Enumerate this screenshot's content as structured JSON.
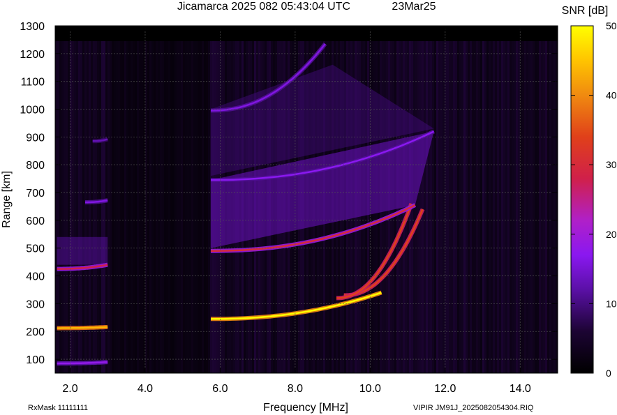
{
  "chart_data": {
    "type": "heatmap",
    "title": "Jicamarca 2025 082 05:43:04 UTC",
    "date": "23Mar25",
    "xlabel": "Frequency [MHz]",
    "ylabel": "Range [km]",
    "xlim": [
      1.6,
      15.0
    ],
    "ylim": [
      50,
      1300
    ],
    "x_ticks": [
      "2.0",
      "4.0",
      "6.0",
      "8.0",
      "10.0",
      "12.0",
      "14.0"
    ],
    "x_tick_values": [
      2.0,
      4.0,
      6.0,
      8.0,
      10.0,
      12.0,
      14.0
    ],
    "y_ticks": [
      "100",
      "200",
      "300",
      "400",
      "500",
      "600",
      "700",
      "800",
      "900",
      "1000",
      "1100",
      "1200",
      "1300"
    ],
    "y_tick_values": [
      100,
      200,
      300,
      400,
      500,
      600,
      700,
      800,
      900,
      1000,
      1100,
      1200,
      1300
    ],
    "grid": true,
    "colorbar": {
      "label": "SNR [dB]",
      "min": 0,
      "max": 50,
      "ticks": [
        "0",
        "10",
        "20",
        "30",
        "40",
        "50"
      ],
      "tick_values": [
        0,
        10,
        20,
        30,
        40,
        50
      ]
    },
    "traces": [
      {
        "f0": 1.65,
        "f1": 3.0,
        "range": [
          212,
          216
        ],
        "snr": [
          36,
          40
        ]
      },
      {
        "f0": 1.65,
        "f1": 3.0,
        "range": [
          425,
          440
        ],
        "snr": [
          14,
          24
        ]
      },
      {
        "f0": 2.4,
        "f1": 3.0,
        "range": [
          665,
          672
        ],
        "snr": [
          10,
          12
        ]
      },
      {
        "f0": 2.6,
        "f1": 3.0,
        "range": [
          885,
          892
        ],
        "snr": [
          8,
          9
        ]
      },
      {
        "f0": 1.65,
        "f1": 3.0,
        "range": [
          85,
          90
        ],
        "snr": [
          12,
          14
        ]
      },
      {
        "f0": 5.75,
        "f1": 10.3,
        "range": [
          245,
          340
        ],
        "snr": [
          34,
          46
        ]
      },
      {
        "f0": 9.3,
        "f1": 11.4,
        "range": [
          330,
          640
        ],
        "snr": [
          30,
          24
        ]
      },
      {
        "f0": 9.1,
        "f1": 11.1,
        "range": [
          320,
          660
        ],
        "snr": [
          30,
          24
        ]
      },
      {
        "f0": 5.75,
        "f1": 11.2,
        "range": [
          490,
          655
        ],
        "snr": [
          26,
          12
        ]
      },
      {
        "f0": 5.75,
        "f1": 11.7,
        "range": [
          745,
          920
        ],
        "snr": [
          13,
          9
        ]
      },
      {
        "f0": 5.75,
        "f1": 8.8,
        "range": [
          995,
          1235
        ],
        "snr": [
          12,
          10
        ]
      }
    ]
  },
  "footer": {
    "rxmask": "RxMask 11111111",
    "file": "VIPIR  JM91J_2025082054304.RIQ"
  },
  "colors": {
    "background": "#000000",
    "noise": "#1a0530",
    "low": "#6a0ad8",
    "mid": "#d02828",
    "high": "#ffe600"
  }
}
